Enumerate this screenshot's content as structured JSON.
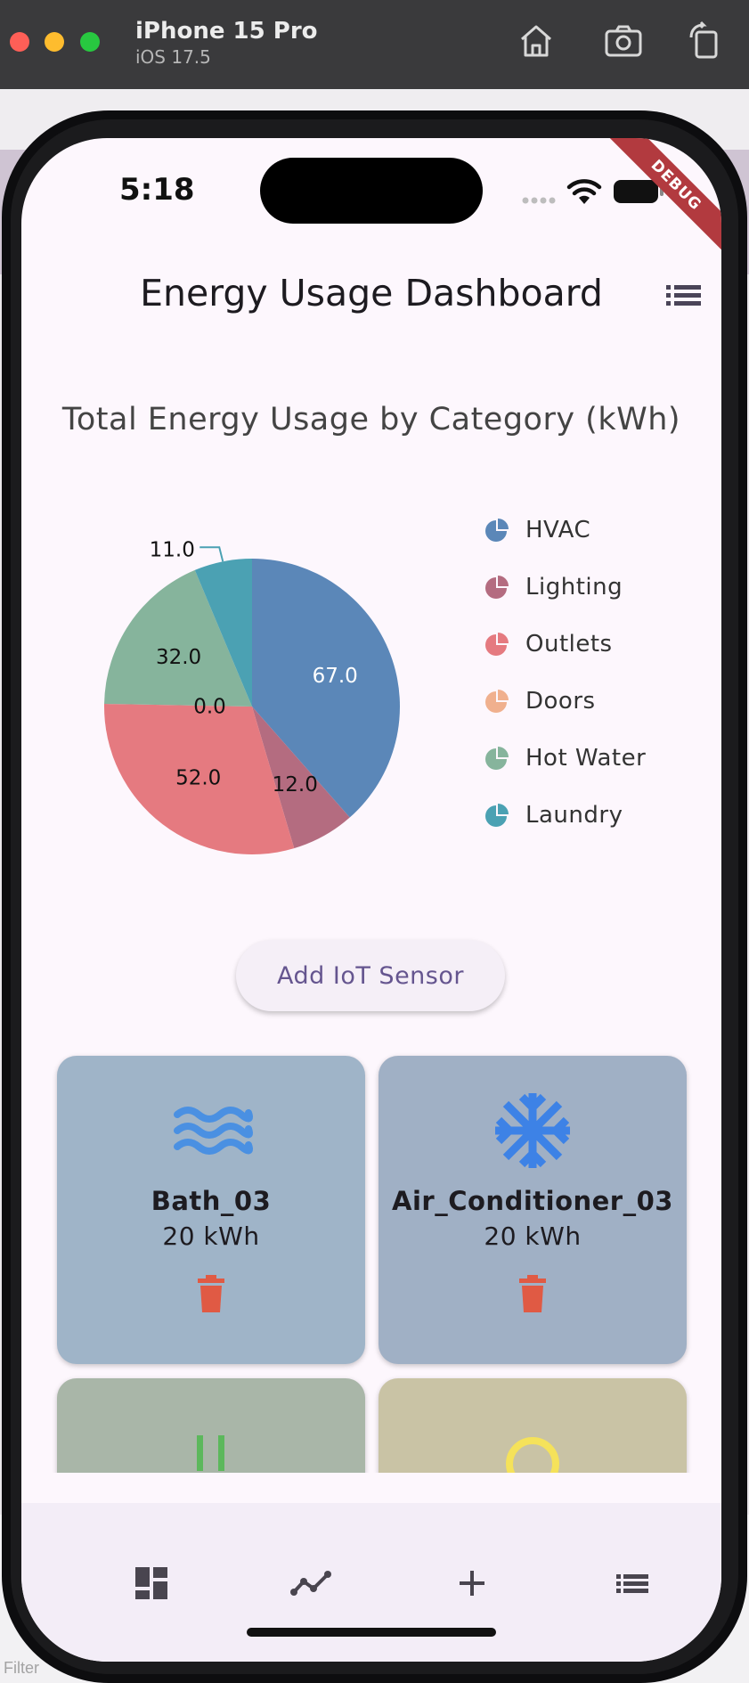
{
  "simulator": {
    "device_name": "iPhone 15 Pro",
    "os_version": "iOS 17.5",
    "icons": [
      "home-icon",
      "screenshot-icon",
      "rotate-icon"
    ]
  },
  "host": {
    "filter_label": "Filter"
  },
  "status_bar": {
    "time": "5:18",
    "debug_banner": "DEBUG"
  },
  "app_bar": {
    "title": "Energy Usage Dashboard",
    "menu_icon": "list-icon"
  },
  "chart_data": {
    "type": "pie",
    "title": "Total Energy Usage by Category (kWh)",
    "categories": [
      "HVAC",
      "Lighting",
      "Outlets",
      "Doors",
      "Hot Water",
      "Laundry"
    ],
    "values": [
      67.0,
      12.0,
      52.0,
      0.0,
      32.0,
      11.0
    ],
    "value_labels": [
      "67.0",
      "12.0",
      "52.0",
      "0.0",
      "32.0",
      "11.0"
    ],
    "colors": [
      "#5b87b8",
      "#b46c80",
      "#e57a80",
      "#f0b08e",
      "#86b49c",
      "#4ba1b3"
    ],
    "legend_position": "right",
    "start_angle": "top, clockwise"
  },
  "actions": {
    "add_sensor_label": "Add IoT Sensor"
  },
  "sensors": [
    {
      "name": "Bath_03",
      "value": "20 kWh",
      "icon": "water-waves-icon",
      "icon_color": "#4a90e2",
      "card_color": "#9fb4c8"
    },
    {
      "name": "Air_Conditioner_03",
      "value": "20 kWh",
      "icon": "snowflake-icon",
      "icon_color": "#3d82e6",
      "card_color": "#a0b0c5"
    },
    {
      "name": "",
      "value": "",
      "icon": "power-plug-icon",
      "icon_color": "#5cb85c",
      "card_color": "#a9b6a8"
    },
    {
      "name": "",
      "value": "",
      "icon": "lightbulb-icon",
      "icon_color": "#f5e25a",
      "card_color": "#c9c3a5"
    }
  ],
  "delete_icon_color": "#e05a44",
  "bottom_nav": {
    "items": [
      "dashboard-icon",
      "analytics-icon",
      "add-icon",
      "list-icon"
    ]
  }
}
